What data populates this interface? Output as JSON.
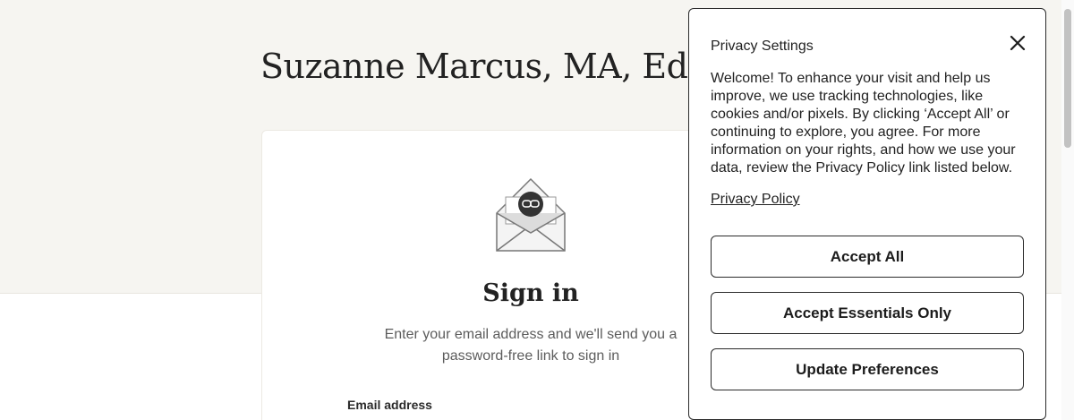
{
  "header": {
    "title": "Suzanne Marcus, MA, EdM"
  },
  "signin": {
    "title": "Sign in",
    "description": "Enter your email address and we'll send you a password-free link to sign in",
    "email_label": "Email address"
  },
  "privacy": {
    "title": "Privacy Settings",
    "body": "Welcome! To enhance your visit and help us improve, we use tracking technologies, like cookies and/or pixels. By clicking ‘Accept All’ or continuing to explore, you agree. For more information on your rights, and how we use your data, review the Privacy Policy link listed below.",
    "policy_link": "Privacy Policy",
    "buttons": {
      "accept_all": "Accept All",
      "accept_essentials": "Accept Essentials Only",
      "update_preferences": "Update Preferences"
    }
  },
  "colors": {
    "header_background": "#f6f5f1",
    "text": "#222222",
    "muted_text": "#5c5c5c",
    "border": "#2b2b2b"
  },
  "icons": {
    "envelope": "envelope-link-icon",
    "close": "close-icon"
  }
}
